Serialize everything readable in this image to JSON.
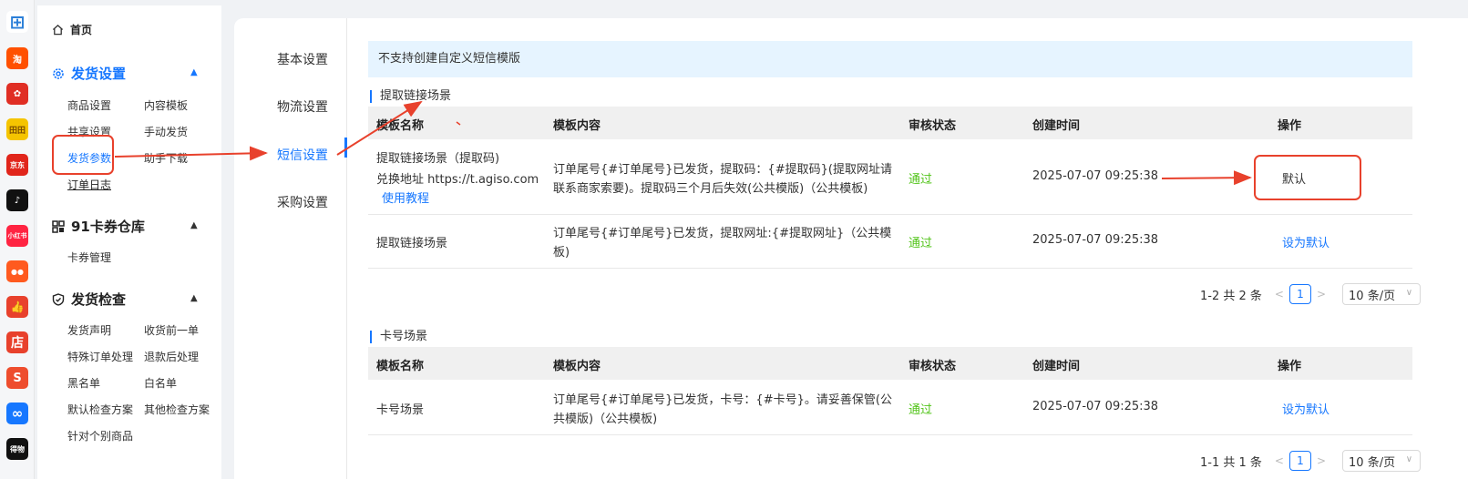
{
  "rail": {
    "icons": [
      {
        "name": "grid-app-icon",
        "glyph": "⊞",
        "color": "#2b7fd8"
      },
      {
        "name": "taobao-icon",
        "glyph": "淘",
        "color": "#ff5000"
      },
      {
        "name": "pinduoduo-icon",
        "glyph": "✿",
        "color": "#e02e24"
      },
      {
        "name": "tiantian-icon",
        "glyph": "田田",
        "color": "#f5c400"
      },
      {
        "name": "jd-icon",
        "glyph": "京东",
        "color": "#e1251b"
      },
      {
        "name": "tiktok-icon",
        "glyph": "♪",
        "color": "#111111"
      },
      {
        "name": "xiaohongshu-icon",
        "glyph": "小红书",
        "color": "#ff2442"
      },
      {
        "name": "kuaishou-icon",
        "glyph": "●●",
        "color": "#ff5a1f"
      },
      {
        "name": "thumbsup-icon",
        "glyph": "👍",
        "color": "#e8412c"
      },
      {
        "name": "shop-icon",
        "glyph": "店",
        "color": "#e8412c"
      },
      {
        "name": "shopee-icon",
        "glyph": "S",
        "color": "#ee4d2d"
      },
      {
        "name": "link-app-icon",
        "glyph": "∞",
        "color": "#1677ff"
      },
      {
        "name": "dewu-icon",
        "glyph": "得物",
        "color": "#111111"
      }
    ]
  },
  "sidebar": {
    "home": "首页",
    "groups": [
      {
        "title": "发货设置",
        "items": [
          "商品设置",
          "内容模板",
          "共享设置",
          "手动发货",
          "发货参数",
          "助手下载",
          "订单日志"
        ]
      },
      {
        "title": "91卡券仓库",
        "items": [
          "卡券管理"
        ]
      },
      {
        "title": "发货检查",
        "items": [
          "发货声明",
          "收货前一单",
          "特殊订单处理",
          "退款后处理",
          "黑名单",
          "白名单",
          "默认检查方案",
          "其他检查方案",
          "针对个别商品"
        ]
      }
    ]
  },
  "tabs": [
    "基本设置",
    "物流设置",
    "短信设置",
    "采购设置"
  ],
  "notice": "不支持创建自定义短信模版",
  "columns": [
    "模板名称",
    "模板内容",
    "审核状态",
    "创建时间",
    "操作"
  ],
  "sections": [
    {
      "title": "提取链接场景",
      "rows": [
        {
          "name_line1": "提取链接场景（提取码)",
          "name_line2": "兑换地址 https://t.agiso.com",
          "name_link": "使用教程",
          "content_line1": "订单尾号{#订单尾号}已发货，提取码：{#提取码}(提取网址请",
          "content_line2": "联系商家索要)。提取码三个月后失效(公共模版)（公共模板)",
          "status": "通过",
          "created": "2025-07-07 09:25:38",
          "action": "默认"
        },
        {
          "name_line1": "提取链接场景",
          "content_line1": "订单尾号{#订单尾号}已发货，提取网址:{#提取网址}（公共模",
          "content_line2": "板)",
          "status": "通过",
          "created": "2025-07-07 09:25:38",
          "action": "设为默认"
        }
      ],
      "pager": {
        "summary": "1-2 共 2 条",
        "page": "1",
        "page_size": "10 条/页"
      }
    },
    {
      "title": "卡号场景",
      "rows": [
        {
          "name_line1": "卡号场景",
          "content_line1": "订单尾号{#订单尾号}已发货，卡号：{#卡号}。请妥善保管(公",
          "content_line2": "共模版)（公共模板)",
          "status": "通过",
          "created": "2025-07-07 09:25:38",
          "action": "设为默认"
        }
      ],
      "pager": {
        "summary": "1-1 共 1 条",
        "page": "1",
        "page_size": "10 条/页"
      }
    }
  ],
  "colors": {
    "accent": "#1677ff",
    "pass": "#52c41a",
    "annotation": "#e8412c"
  }
}
